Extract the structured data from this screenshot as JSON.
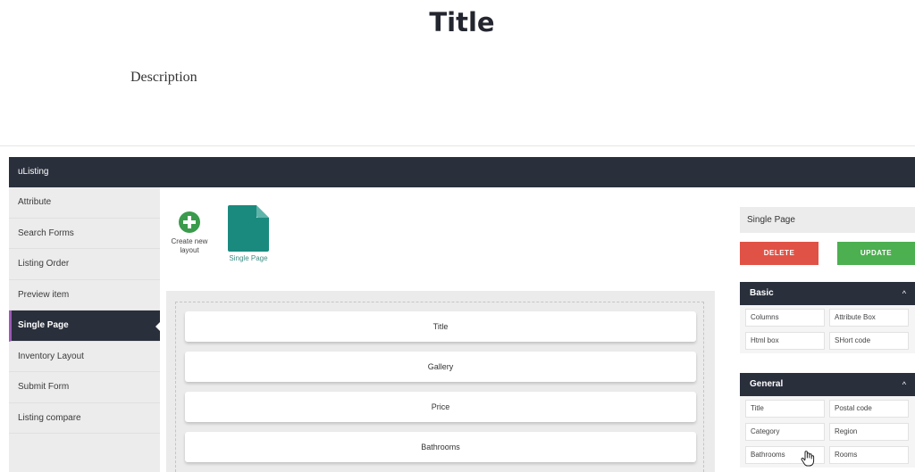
{
  "page": {
    "title": "Title",
    "description": "Description"
  },
  "app": {
    "name": "uListing"
  },
  "sidebar": {
    "items": [
      {
        "label": "Attribute",
        "active": false
      },
      {
        "label": "Search Forms",
        "active": false
      },
      {
        "label": "Listing Order",
        "active": false
      },
      {
        "label": "Preview item",
        "active": false
      },
      {
        "label": "Single Page",
        "active": true
      },
      {
        "label": "Inventory Layout",
        "active": false
      },
      {
        "label": "Submit Form",
        "active": false
      },
      {
        "label": "Listing compare",
        "active": false
      }
    ]
  },
  "layouts": {
    "create_label_line1": "Create new",
    "create_label_line2": "layout",
    "single_page_label": "Single Page",
    "create_icon": "plus-circle-icon",
    "doc_icon": "document-icon"
  },
  "builder": {
    "blocks": [
      "Title",
      "Gallery",
      "Price",
      "Bathrooms"
    ]
  },
  "right_panel": {
    "title": "Single Page",
    "delete_label": "DELETE",
    "update_label": "UPDATE",
    "sections": [
      {
        "title": "Basic",
        "fields": [
          "Columns",
          "Attribute Box",
          "Html box",
          "SHort code"
        ]
      },
      {
        "title": "General",
        "fields": [
          "Title",
          "Postal code",
          "Category",
          "Region",
          "Bathrooms",
          "Rooms"
        ]
      }
    ]
  },
  "colors": {
    "dark_bar": "#2a2f3c",
    "accent": "#9b59b6",
    "delete": "#e15246",
    "update": "#4caf50",
    "doc": "#1a8a7e",
    "create": "#3a9b4c"
  }
}
